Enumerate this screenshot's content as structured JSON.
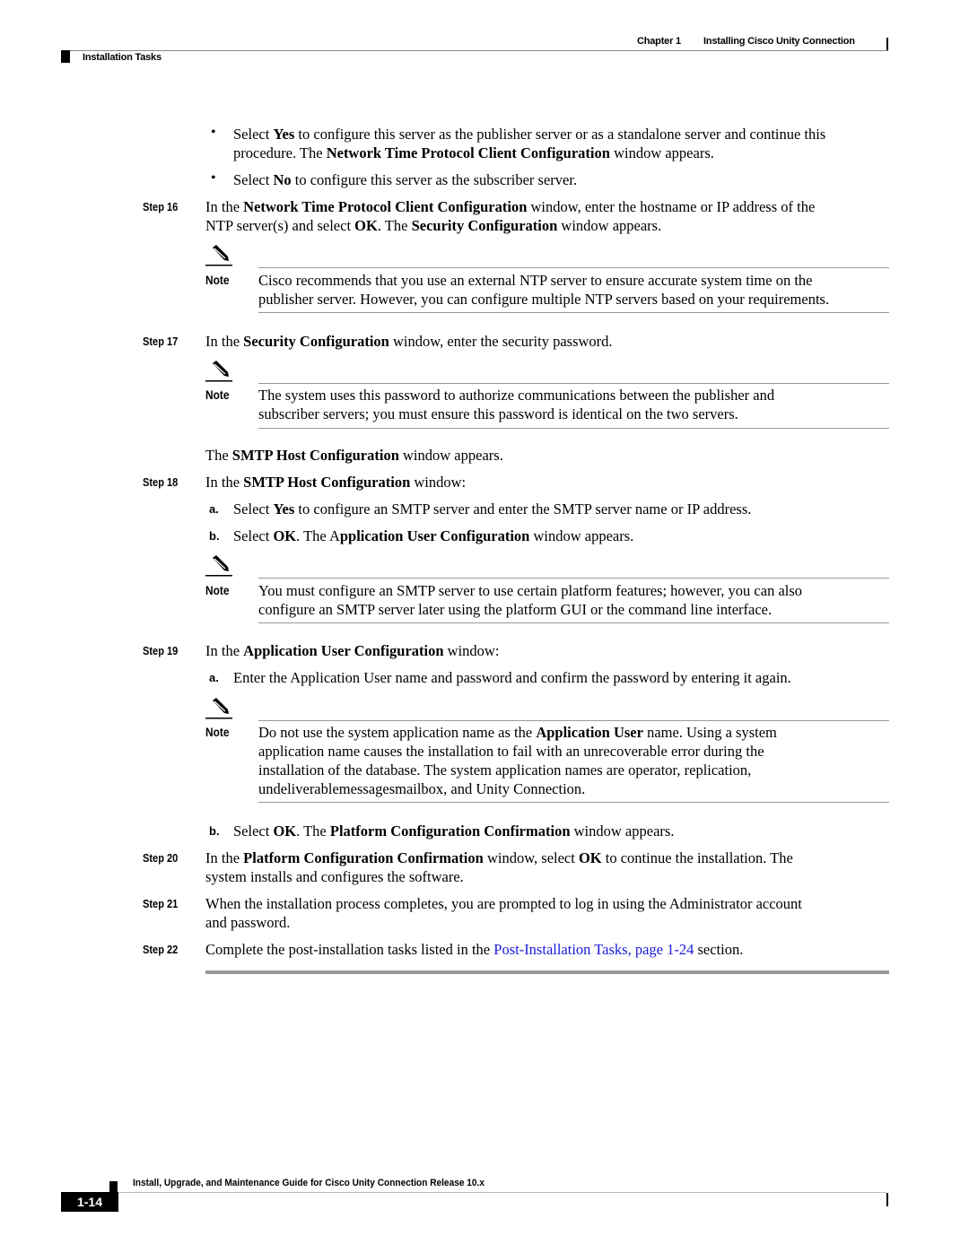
{
  "header": {
    "chapter": "Chapter 1",
    "chapter_title": "Installing Cisco Unity Connection",
    "section": "Installation Tasks"
  },
  "bullets": [
    {
      "pre": "Select ",
      "b1": "Yes",
      "mid": " to configure this server as the publisher server or as a standalone server and continue this",
      "line2_pre": "procedure. The ",
      "b2": "Network Time Protocol Client Configuration",
      "post": " window appears."
    },
    {
      "pre": "Select ",
      "b1": "No",
      "post": " to configure this server as the subscriber server."
    }
  ],
  "steps": {
    "s16": {
      "label": "Step 16",
      "t1": "In the ",
      "b1": "Network Time Protocol Client Configuration",
      "t2": " window, enter the hostname or IP address of the",
      "t3": "NTP server(s) and select ",
      "b2": "OK",
      "t4": ". The ",
      "b3": "Security Configuration",
      "t5": " window appears."
    },
    "s17": {
      "label": "Step 17",
      "t1": "In the ",
      "b1": "Security Configuration",
      "t2": " window, enter the security password."
    },
    "smtp_intro": {
      "t1": "The ",
      "b1": "SMTP Host Configuration",
      "t2": " window appears."
    },
    "s18": {
      "label": "Step 18",
      "t1": "In the ",
      "b1": "SMTP Host Configuration",
      "t2": " window:",
      "a": {
        "label": "a.",
        "t1": "Select ",
        "b1": "Yes",
        "t2": " to configure an SMTP server and enter the SMTP server name or IP address."
      },
      "b": {
        "label": "b.",
        "t1": "Select ",
        "b1": "OK",
        "t2": ". The A",
        "b2": "pplication User Configuration",
        "t3": " window appears."
      }
    },
    "s19": {
      "label": "Step 19",
      "t1": "In the ",
      "b1": "Application User Configuration",
      "t2": " window:",
      "a": {
        "label": "a.",
        "t1": "Enter the Application User name and password and confirm the password by entering it again."
      },
      "b": {
        "label": "b.",
        "t1": "Select ",
        "b1": "OK",
        "t2": ". The ",
        "b2": "Platform Configuration Confirmation",
        "t3": " window appears."
      }
    },
    "s20": {
      "label": "Step 20",
      "t1": "In the ",
      "b1": "Platform Configuration Confirmation",
      "t2": " window, select ",
      "b2": "OK",
      "t3": " to continue the installation. The",
      "t4": "system installs and configures the software."
    },
    "s21": {
      "label": "Step 21",
      "t1": "When the installation process completes, you are prompted to log in using the Administrator account",
      "t2": "and password."
    },
    "s22": {
      "label": "Step 22",
      "t1": "Complete the post-installation tasks listed in the ",
      "link": "Post-Installation Tasks, page 1-24",
      "t2": " section."
    }
  },
  "notes": [
    {
      "label": "Note",
      "l1": "Cisco recommends that you use an external NTP server to ensure accurate system time on the",
      "l2": "publisher server. However, you can configure multiple NTP servers based on your requirements."
    },
    {
      "label": "Note",
      "l1": "The system uses this password to authorize communications between the publisher and",
      "l2": "subscriber servers; you must ensure this password is identical on the two servers."
    },
    {
      "label": "Note",
      "l1": "You must configure an SMTP server to use certain platform features; however, you can also",
      "l2": "configure an SMTP server later using the platform GUI or the command line interface."
    },
    {
      "label": "Note",
      "l1a": "Do not use the system application name as the ",
      "l1b": "Application User",
      "l1c": " name. Using a system",
      "l2": "application name causes the installation to fail with an unrecoverable error during the",
      "l3": "installation of the database. The system application names are operator, replication,",
      "l4": "undeliverablemessagesmailbox, and Unity Connection."
    }
  ],
  "footer": {
    "guide_title": "Install, Upgrade, and Maintenance Guide for Cisco Unity Connection Release 10.x",
    "page_number": "1-14"
  }
}
